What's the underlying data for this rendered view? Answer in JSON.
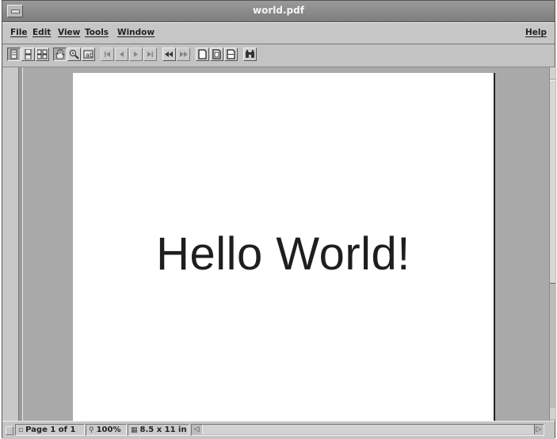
{
  "window": {
    "title": "world.pdf"
  },
  "menubar": {
    "items": [
      {
        "label": "File"
      },
      {
        "label": "Edit"
      },
      {
        "label": "View"
      },
      {
        "label": "Tools"
      },
      {
        "label": "Window"
      }
    ],
    "help": "Help"
  },
  "toolbar": {
    "buttons": [
      "single-page-icon",
      "continuous-page-icon",
      "facing-pages-icon",
      "hand-tool-icon",
      "zoom-tool-icon",
      "text-select-icon",
      "first-page-icon",
      "previous-page-icon",
      "next-page-icon",
      "last-page-icon",
      "go-back-icon",
      "go-forward-icon",
      "actual-size-icon",
      "fit-page-icon",
      "fit-width-icon",
      "find-icon"
    ]
  },
  "document": {
    "text": "Hello World!"
  },
  "statusbar": {
    "page": "Page 1 of 1",
    "zoom": "100%",
    "page_size": "8.5 x 11 in"
  },
  "colors": {
    "window_bg": "#c8c8c8",
    "titlebar": "#8c8c8c",
    "viewport_bg": "#a9a9a9",
    "page": "#ffffff",
    "text": "#1e1e1e"
  }
}
